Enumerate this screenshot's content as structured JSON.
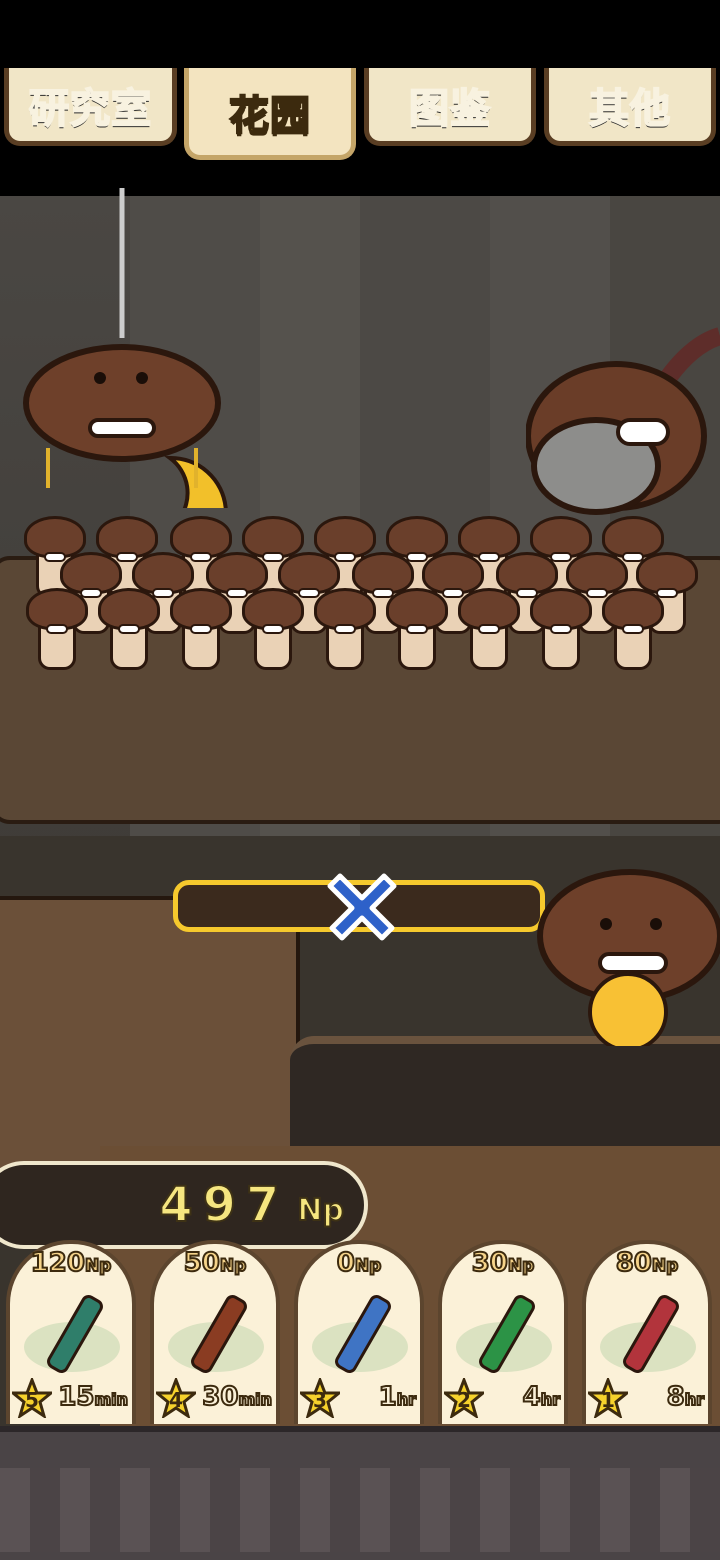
{
  "tabs": [
    {
      "label": "研究室"
    },
    {
      "label": "花园",
      "active": true
    },
    {
      "label": "图鉴"
    },
    {
      "label": "其他"
    }
  ],
  "garden": {
    "mushroom_count": 31,
    "harvest_progress": 0.5
  },
  "np_display": {
    "value": "497",
    "unit": "Np"
  },
  "items": [
    {
      "price": "120",
      "price_unit": "Np",
      "rank": "5",
      "time": "15",
      "time_unit": "min",
      "color": "#2f7e6a",
      "icon": "teal-bottle-icon"
    },
    {
      "price": "50",
      "price_unit": "Np",
      "rank": "4",
      "time": "30",
      "time_unit": "min",
      "color": "#8a3c22",
      "icon": "brown-bottle-icon"
    },
    {
      "price": "0",
      "price_unit": "Np",
      "rank": "3",
      "time": "1",
      "time_unit": "hr",
      "color": "#3f74c4",
      "icon": "blue-dropper-icon"
    },
    {
      "price": "30",
      "price_unit": "Np",
      "rank": "2",
      "time": "4",
      "time_unit": "hr",
      "color": "#2c9346",
      "icon": "green-ampoule-icon"
    },
    {
      "price": "80",
      "price_unit": "Np",
      "rank": "1",
      "time": "8",
      "time_unit": "hr",
      "color": "#b2343c",
      "icon": "red-ampoule-icon"
    }
  ],
  "colors": {
    "active_tab_text": "#ffd21a",
    "progress_border": "#f6c92d",
    "cross": "#2e61c9",
    "np_text": "#f6e680"
  }
}
